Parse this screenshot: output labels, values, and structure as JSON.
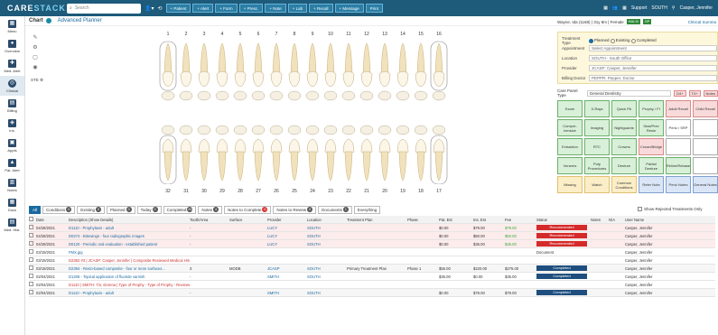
{
  "topbar": {
    "logo_a": "CARE",
    "logo_b": "STACK",
    "search_placeholder": "Search",
    "buttons": [
      "+ Patient",
      "+ Alert",
      "+ Form",
      "+ Presc.",
      "+ Note",
      "+ Lab",
      "+ Recall",
      "+ Message",
      "Print"
    ],
    "support": "Support",
    "office": "SOUTH",
    "user": "Casper, Jennifer"
  },
  "nav": [
    "Menu",
    "Overview",
    "Med. Alert",
    "Clinical",
    "Billing",
    "Ins.",
    "Appts",
    "Pat. Alert",
    "Notes",
    "Docs",
    "Med. Hist."
  ],
  "subhead": {
    "chart": "Chart",
    "advanced": "Advanced Planner",
    "patient": "Wayne, Ida (1168) | 31y 8m | Female",
    "badges": [
      "HAL%",
      "SP"
    ],
    "clinical": "Clinical Summa"
  },
  "teeth": {
    "upper": [
      "1",
      "2",
      "3",
      "4",
      "5",
      "6",
      "7",
      "8",
      "9",
      "10",
      "11",
      "12",
      "13",
      "14",
      "15",
      "16"
    ],
    "lower": [
      "32",
      "31",
      "30",
      "29",
      "28",
      "27",
      "26",
      "25",
      "24",
      "23",
      "22",
      "21",
      "20",
      "19",
      "18",
      "17"
    ],
    "ste_label": "STE"
  },
  "treatment": {
    "type_label": "Treatment Type",
    "type_options": [
      "Planned",
      "Existing",
      "Completed"
    ],
    "appointment_label": "Appointment",
    "appointment_value": "Select Appointment",
    "location_label": "Location",
    "location_value": "SOUTH - South Office",
    "provider_label": "Provider",
    "provider_value": "JCASP: Casper, Jennifer",
    "billing_label": "Billing Doctor",
    "billing_value": "PEPPR: Pepper, Doctor"
  },
  "care_panel": {
    "label": "Care Panel Type",
    "value": "General Dentistry",
    "mini": [
      "D4+",
      "T4+",
      "Notes"
    ]
  },
  "grid": [
    {
      "t": "Exam",
      "c": "g"
    },
    {
      "t": "X-Rays",
      "c": "g"
    },
    {
      "t": "Quick PA",
      "c": "g"
    },
    {
      "t": "Prophy / FI",
      "c": "g"
    },
    {
      "t": "Adult Recall",
      "c": "r"
    },
    {
      "t": "Child Recall",
      "c": "r"
    },
    {
      "t": "Compre-hensive",
      "c": "g"
    },
    {
      "t": "Imaging",
      "c": "g"
    },
    {
      "t": "Nightguards",
      "c": "g"
    },
    {
      "t": "Seal/Prev Resin",
      "c": "g"
    },
    {
      "t": "Perio / SRP",
      "c": "w"
    },
    {
      "t": "",
      "c": "w"
    },
    {
      "t": "Extraction",
      "c": "g"
    },
    {
      "t": "RTC",
      "c": "g"
    },
    {
      "t": "Crowns",
      "c": "g"
    },
    {
      "t": "Crown/Bridge",
      "c": "r"
    },
    {
      "t": "",
      "c": "w"
    },
    {
      "t": "",
      "c": "w"
    },
    {
      "t": "Veneers",
      "c": "g"
    },
    {
      "t": "Pulp Procedures",
      "c": "g"
    },
    {
      "t": "Denture",
      "c": "g"
    },
    {
      "t": "Partial Denture",
      "c": "g"
    },
    {
      "t": "Reline/Rebase",
      "c": "g"
    },
    {
      "t": "",
      "c": "w"
    },
    {
      "t": "Missing",
      "c": "y"
    },
    {
      "t": "Watch",
      "c": "y"
    },
    {
      "t": "Common Conditions",
      "c": "y"
    },
    {
      "t": "Refer Note",
      "c": "b"
    },
    {
      "t": "Perio Notes",
      "c": "b"
    },
    {
      "t": "General Notes",
      "c": "b"
    }
  ],
  "tabs": [
    {
      "label": "All",
      "count": ""
    },
    {
      "label": "Conditions",
      "count": "0",
      "color": ""
    },
    {
      "label": "Existing",
      "count": "0",
      "color": ""
    },
    {
      "label": "Planned",
      "count": "3",
      "color": ""
    },
    {
      "label": "Today",
      "count": "0",
      "color": ""
    },
    {
      "label": "Completed",
      "count": "26",
      "color": ""
    },
    {
      "label": "Notes",
      "count": "4",
      "color": ""
    },
    {
      "label": "Notes to Complete",
      "count": "0",
      "color": "red"
    },
    {
      "label": "Notes to Review",
      "count": "0",
      "color": ""
    },
    {
      "label": "Documents",
      "count": "1",
      "color": ""
    },
    {
      "label": "Everything",
      "count": "",
      "color": ""
    }
  ],
  "show_rejected": "Show Rejected Treatments Only",
  "columns": [
    "Date",
    "Description (Show Details)",
    "Tooth/Area",
    "Surface",
    "Provider",
    "Location",
    "Treatment Plan",
    "Phase",
    "Pat. Est",
    "Ins. Est",
    "Fee",
    "Status",
    "Notes",
    "N/A",
    "User Name"
  ],
  "rows": [
    {
      "date": "04/28/2021",
      "desc": "D1110 - Prophylaxis - adult",
      "tooth": "-",
      "surf": "",
      "prov": "LUCY",
      "loc": "SOUTH",
      "tp": "",
      "ph": "",
      "pest": "$0.00",
      "ins": "$79.00",
      "fee": "$79.00",
      "status": "Recommended",
      "user": "Casper, Jennifer",
      "kind": "pink"
    },
    {
      "date": "04/28/2021",
      "desc": "D0274 - Bitewings - four radiographic images",
      "tooth": "-",
      "surf": "",
      "prov": "LUCY",
      "loc": "SOUTH",
      "tp": "",
      "ph": "",
      "pest": "$0.00",
      "ins": "$50.00",
      "fee": "$50.00",
      "status": "Recommended",
      "user": "Casper, Jennifer",
      "kind": "pink"
    },
    {
      "date": "04/28/2021",
      "desc": "D0120 - Periodic oral evaluation - established patient",
      "tooth": "-",
      "surf": "",
      "prov": "LUCY",
      "loc": "SOUTH",
      "tp": "",
      "ph": "",
      "pest": "$0.00",
      "ins": "$36.00",
      "fee": "$36.00",
      "status": "Recommended",
      "user": "Casper, Jennifer",
      "kind": "pink"
    },
    {
      "date": "03/19/2021",
      "desc": "FMX.jpg",
      "tooth": "",
      "surf": "",
      "prov": "",
      "loc": "",
      "tp": "",
      "ph": "",
      "pest": "",
      "ins": "",
      "fee": "",
      "status": "Document",
      "user": "Casper, Jennifer",
      "kind": "doc"
    },
    {
      "date": "03/19/2021",
      "desc": "D2392 #3 | JCASP: Casper, Jennifer | Composite Reviewed Medical History - Reviewed Medical History - Used pt treatment tickt",
      "tooth": "",
      "surf": "",
      "prov": "",
      "loc": "",
      "tp": "",
      "ph": "",
      "pest": "",
      "ins": "",
      "fee": "",
      "status": "",
      "user": "Casper, Jennifer",
      "kind": "note"
    },
    {
      "date": "03/19/2021",
      "desc": "D2394 - Resin-based composite - four or more surfaces...",
      "tooth": "3",
      "surf": "MODB",
      "prov": "JCASP",
      "loc": "SOUTH",
      "tp": "Primary Treatment Plan",
      "ph": "Phase 1",
      "pest": "$55.00",
      "ins": "$220.00",
      "fee": "$275.00",
      "status": "Completed",
      "user": "Casper, Jennifer",
      "kind": "gray"
    },
    {
      "date": "02/04/2021",
      "desc": "D1206 - Topical application of fluoride varnish",
      "tooth": "-",
      "surf": "",
      "prov": "SMITH",
      "loc": "SOUTH",
      "tp": "",
      "ph": "",
      "pest": "$35.00",
      "ins": "$0.00",
      "fee": "$35.00",
      "status": "Completed",
      "user": "Casper, Jennifer",
      "kind": "plain"
    },
    {
      "date": "02/04/2021",
      "desc": "D1110 | SMITH: Tin, Dorena | Type of Prophy - Type of Prophy - Reviewed Medical History - Reviewed Med",
      "tooth": "",
      "surf": "",
      "prov": "",
      "loc": "",
      "tp": "",
      "ph": "",
      "pest": "",
      "ins": "",
      "fee": "",
      "status": "",
      "user": "Casper, Jennifer",
      "kind": "note"
    },
    {
      "date": "02/04/2021",
      "desc": "D1110 - Prophylaxis - adult",
      "tooth": "-",
      "surf": "",
      "prov": "SMITH",
      "loc": "SOUTH",
      "tp": "",
      "ph": "",
      "pest": "$0.00",
      "ins": "$79.00",
      "fee": "$79.00",
      "status": "Completed",
      "user": "Casper, Jennifer",
      "kind": "gray"
    }
  ]
}
